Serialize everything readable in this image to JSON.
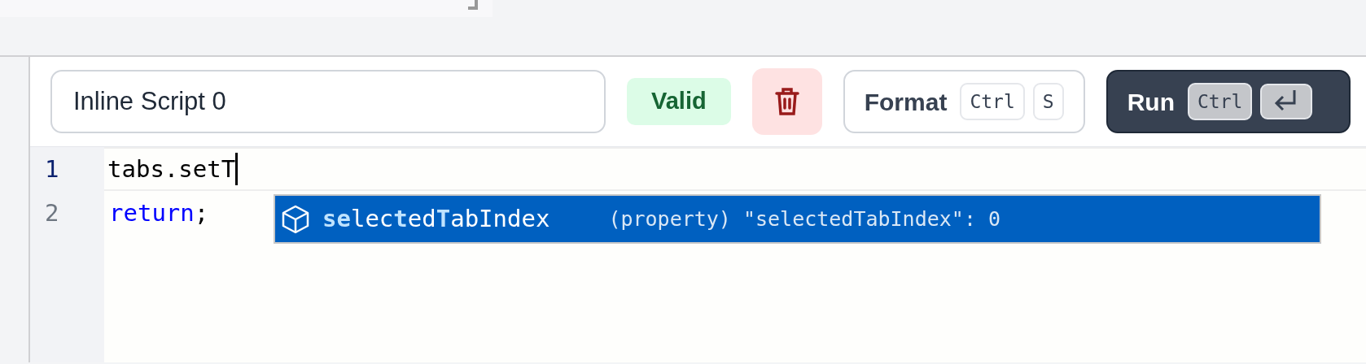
{
  "script_name": {
    "value": "Inline Script 0"
  },
  "status_badge": {
    "label": "Valid",
    "kind": "valid"
  },
  "format_button": {
    "label": "Format",
    "keys": [
      "Ctrl",
      "S"
    ]
  },
  "run_button": {
    "label": "Run",
    "keys": [
      "Ctrl"
    ]
  },
  "editor": {
    "lines": [
      {
        "number": "1",
        "current": true,
        "tokens": [
          {
            "text": "tabs.setT",
            "kind": "plain"
          }
        ]
      },
      {
        "number": "2",
        "current": false,
        "tokens": [
          {
            "text": "return",
            "kind": "keyword"
          },
          {
            "text": ";",
            "kind": "plain"
          }
        ]
      }
    ],
    "suggestions": [
      {
        "label": "**se**lec**t**ed**T**abIndex",
        "detail": "(property) \"selectedTabIndex\": 0",
        "selected": true
      }
    ]
  }
}
